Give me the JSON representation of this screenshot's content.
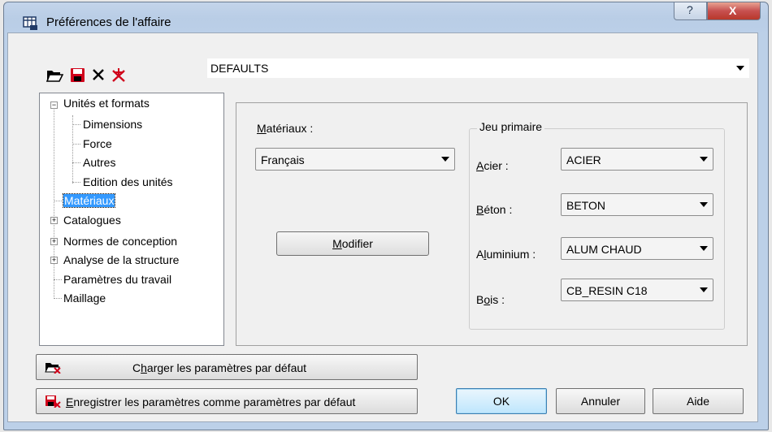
{
  "window": {
    "title": "Préférences de l'affaire",
    "help_label": "?",
    "close_label": "X"
  },
  "toolbar": {
    "icons": [
      "open-folder-icon",
      "save-icon",
      "delete-icon",
      "delete-all-icon"
    ],
    "preset_value": "DEFAULTS"
  },
  "tree": {
    "items": [
      {
        "label": "Unités et formats",
        "expander": "−"
      },
      {
        "label": "Dimensions"
      },
      {
        "label": "Force"
      },
      {
        "label": "Autres"
      },
      {
        "label": "Edition des unités"
      },
      {
        "label": "Matériaux",
        "selected": true
      },
      {
        "label": "Catalogues",
        "expander": "+"
      },
      {
        "label": "Normes de conception",
        "expander": "+"
      },
      {
        "label": "Analyse de la structure",
        "expander": "+"
      },
      {
        "label": "Paramètres du travail"
      },
      {
        "label": "Maillage"
      }
    ]
  },
  "materials": {
    "label_u": "M",
    "label_rest": "atériaux :",
    "selected": "Français",
    "modify_u": "M",
    "modify_rest": "odifier"
  },
  "primary": {
    "title": "Jeu primaire",
    "rows": [
      {
        "label_u": "A",
        "label_rest": "cier :",
        "value": "ACIER"
      },
      {
        "label_u": "B",
        "label_rest": "éton :",
        "value": "BETON"
      },
      {
        "label_pre": "A",
        "label_u": "l",
        "label_rest": "uminium :",
        "value": "ALUM CHAUD"
      },
      {
        "label_pre": "B",
        "label_u": "o",
        "label_rest": "is :",
        "value": "CB_RESIN C18"
      }
    ]
  },
  "buttons": {
    "load_pre": "C",
    "load_u": "h",
    "load_rest": "arger les paramètres par défaut",
    "save_u": "E",
    "save_rest": "nregistrer les paramètres comme paramètres par défaut",
    "ok": "OK",
    "cancel": "Annuler",
    "help": "Aide"
  },
  "colors": {
    "selection": "#3399ff",
    "ok_border": "#3c7fb1",
    "close_red": "#c75050",
    "icon_red": "#d0021b"
  }
}
